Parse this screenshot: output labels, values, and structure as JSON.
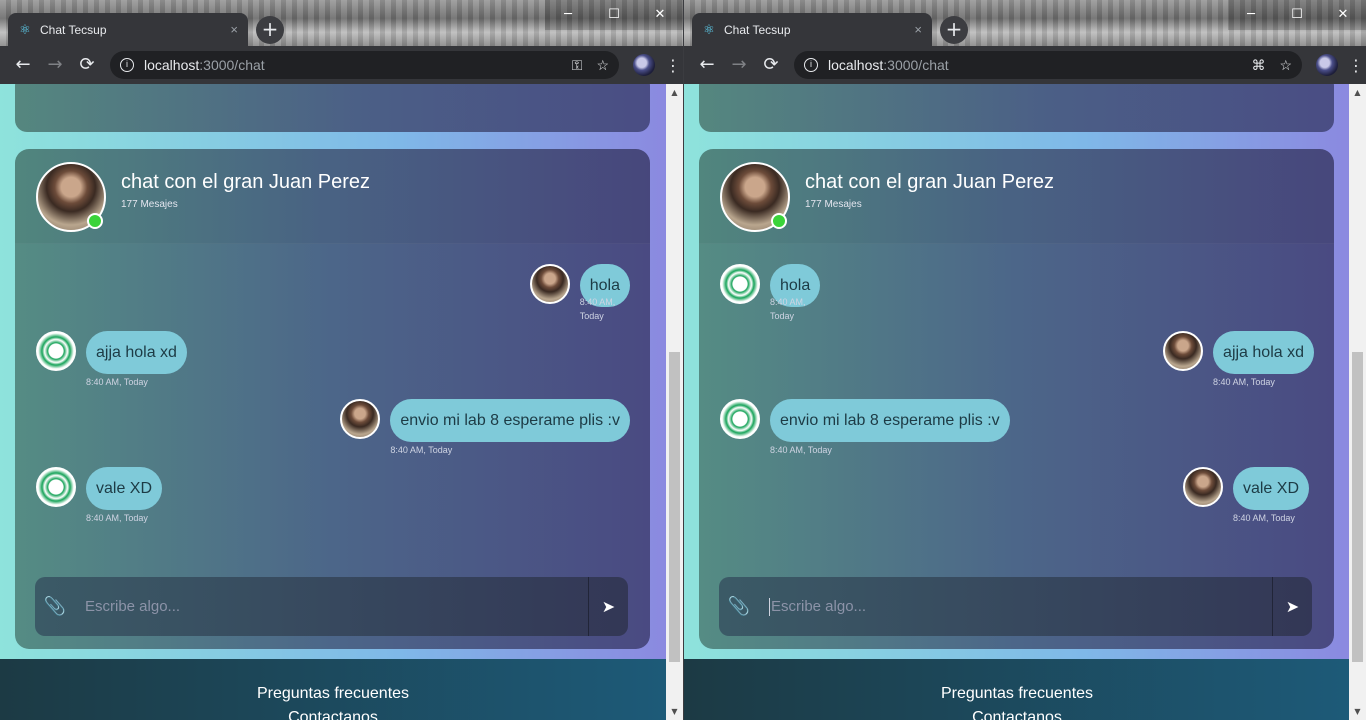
{
  "browser": {
    "tab_title": "Chat Tecsup",
    "tab_close": "×",
    "new_tab": "+",
    "url_host": "localhost",
    "url_path": ":3000/chat",
    "min": "─",
    "max": "☐",
    "close": "✕"
  },
  "chat": {
    "title": "chat con el gran Juan Perez",
    "count": "177 Mesajes",
    "placeholder": "Escribe algo..."
  },
  "left_messages": [
    {
      "text": "hola",
      "time": "8:40 AM, Today",
      "side": "right",
      "avatar": "user"
    },
    {
      "text": "ajja hola xd",
      "time": "8:40 AM, Today",
      "side": "left",
      "avatar": "bot"
    },
    {
      "text": "envio mi lab 8 esperame plis :v",
      "time": "8:40 AM, Today",
      "side": "right",
      "avatar": "user"
    },
    {
      "text": "vale XD",
      "time": "8:40 AM, Today",
      "side": "left",
      "avatar": "bot"
    }
  ],
  "right_messages": [
    {
      "text": "hola",
      "time": "8:40 AM, Today",
      "side": "left",
      "avatar": "bot"
    },
    {
      "text": "ajja hola xd",
      "time": "8:40 AM, Today",
      "side": "right",
      "avatar": "user"
    },
    {
      "text": "envio mi lab 8 esperame plis :v",
      "time": "8:40 AM, Today",
      "side": "left",
      "avatar": "bot"
    },
    {
      "text": "vale XD",
      "time": "8:40 AM, Today",
      "side": "right",
      "avatar": "user"
    }
  ],
  "footer": {
    "faq": "Preguntas frecuentes",
    "contact": "Contactanos"
  },
  "icons": {
    "favicon": "react-icon",
    "attach": "paperclip-icon",
    "send": "send-icon",
    "key": "key-icon",
    "translate": "translate-icon",
    "star": "star-icon"
  }
}
